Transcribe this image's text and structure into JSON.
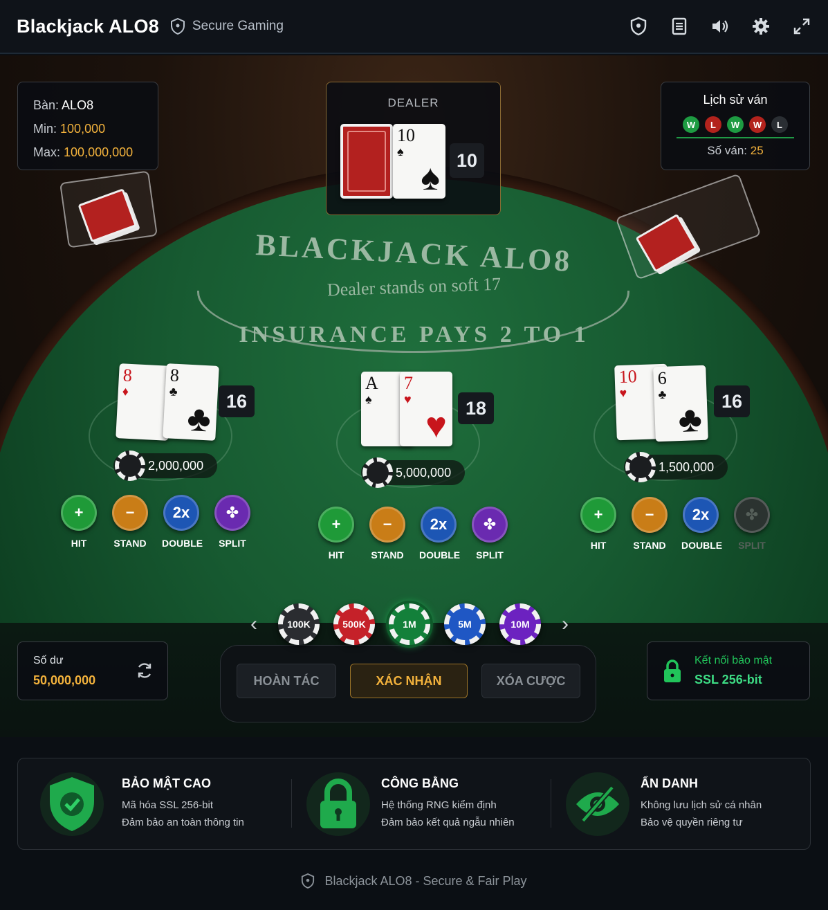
{
  "header": {
    "title": "Blackjack ALO8",
    "secure_label": "Secure Gaming",
    "icons": [
      "shield-icon",
      "rules-icon",
      "volume-icon",
      "settings-icon",
      "fullscreen-icon"
    ]
  },
  "table_info": {
    "table_label": "Bàn:",
    "table_value": "ALO8",
    "min_label": "Min:",
    "min_value": "100,000",
    "max_label": "Max:",
    "max_value": "100,000,000"
  },
  "dealer": {
    "label": "DEALER",
    "score": "10",
    "up_card": {
      "rank": "10",
      "suit": "♠"
    }
  },
  "history": {
    "title": "Lịch sử ván",
    "results": [
      "W",
      "L",
      "W",
      "W",
      "L"
    ],
    "count_label": "Số ván:",
    "count_value": "25"
  },
  "felt": {
    "title": "BLACKJACK ALO8",
    "subtitle": "Dealer stands on soft 17",
    "insurance": "INSURANCE PAYS 2 TO 1"
  },
  "hands": [
    {
      "cards": [
        {
          "rank": "8",
          "suit": "♦",
          "color": "red"
        },
        {
          "rank": "8",
          "suit": "♣",
          "color": "black"
        }
      ],
      "score": "16",
      "bet": "2,000,000"
    },
    {
      "cards": [
        {
          "rank": "A",
          "suit": "♠",
          "color": "black"
        },
        {
          "rank": "7",
          "suit": "♥",
          "color": "red"
        }
      ],
      "score": "18",
      "bet": "5,000,000"
    },
    {
      "cards": [
        {
          "rank": "10",
          "suit": "♥",
          "color": "red"
        },
        {
          "rank": "6",
          "suit": "♣",
          "color": "black"
        }
      ],
      "score": "16",
      "bet": "1,500,000"
    }
  ],
  "actions": {
    "hit": "HIT",
    "stand": "STAND",
    "double": "DOUBLE",
    "split": "SPLIT",
    "double_symbol": "2x"
  },
  "chips": [
    "100K",
    "500K",
    "1M",
    "5M",
    "10M"
  ],
  "selected_chip": "1M",
  "controls": {
    "undo": "HOÀN TÁC",
    "confirm": "XÁC NHẬN",
    "clear": "XÓA CƯỢC"
  },
  "balance": {
    "label": "Số dư",
    "value": "50,000,000"
  },
  "ssl": {
    "label": "Kết nối bảo mật",
    "value": "SSL 256-bit"
  },
  "features": [
    {
      "title": "BẢO MẬT CAO",
      "line1": "Mã hóa SSL 256-bit",
      "line2": "Đảm bảo an toàn thông tin"
    },
    {
      "title": "CÔNG BẰNG",
      "line1": "Hệ thống RNG kiểm định",
      "line2": "Đảm bảo kết quả ngẫu nhiên"
    },
    {
      "title": "ẨN DANH",
      "line1": "Không lưu lịch sử cá nhân",
      "line2": "Bảo vệ quyền riêng tư"
    }
  ],
  "footer": "Blackjack ALO8 - Secure & Fair Play",
  "colors": {
    "accent_gold": "#f3b23c",
    "accent_green": "#21c45a",
    "felt_green": "#175a31"
  }
}
